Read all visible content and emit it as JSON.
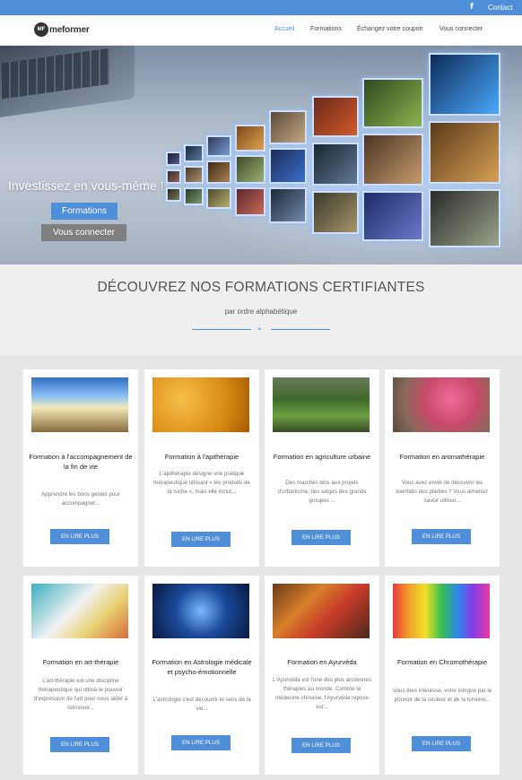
{
  "topbar": {
    "facebook_icon": "f",
    "contact": "Contact"
  },
  "header": {
    "logo_mark": "MF",
    "logo_text": "meformer",
    "nav": [
      "Accueil",
      "Formations",
      "Échangez votre coupon",
      "Vous connecter"
    ]
  },
  "hero": {
    "title": "Investissez en vous-même !",
    "btn_formations": "Formations",
    "btn_connect": "Vous connecter"
  },
  "section": {
    "title": "DÉCOUVREZ NOS FORMATIONS CERTIFIANTES",
    "subtitle": "par ordre alphabétique",
    "chevron_icon": "chevron-down"
  },
  "cards": [
    {
      "title": "Formation à l'accompagnement de la fin de vie",
      "desc": "Apprendre les bons gestes pour accompagner...",
      "more": "EN LIRE PLUS"
    },
    {
      "title": "Formation à l'apithérapie",
      "desc": "L'apithérapie désigne une pratique thérapeutique utilisant « les produits de la ruche », mais elle inclut...",
      "more": "EN LIRE PLUS"
    },
    {
      "title": "Formation en agriculture urbaine",
      "desc": "Des marchés bios aux projets d'urbanisme, des sièges des grands groupes ...",
      "more": "EN LIRE PLUS"
    },
    {
      "title": "Formation en aromathérapie",
      "desc": "Vous avez envie de découvrir les bienfaits des plantes ? Vous aimeriez savoir utiliser...",
      "more": "EN LIRE PLUS"
    },
    {
      "title": "Formation en art-thérapie",
      "desc": "L'art-thérapie est une discipline thérapeutique qui utilise le pouvoir d'expression de l'art pour nous aider à retrouver...",
      "more": "EN LIRE PLUS"
    },
    {
      "title": "Formation en Astrologie médicale et psycho-émotionnelle",
      "desc": "L'astrologie c'est découvrir le sens de la vie...",
      "more": "EN LIRE PLUS"
    },
    {
      "title": "Formation en Ayurvéda",
      "desc": "L'Ayurvéda est l'une des plus anciennes thérapies au monde. Comme la médecine chinoise, l'Ayurvéda repose sur...",
      "more": "EN LIRE PLUS"
    },
    {
      "title": "Formation en Chromothérapie",
      "desc": "Vous êtes intéressé, votre intrigué par le pouvoir de la couleur et de la lumière...",
      "more": "EN LIRE PLUS"
    }
  ],
  "colors": {
    "accent": "#4f8ed9",
    "grey_button": "#7f7f7f"
  }
}
